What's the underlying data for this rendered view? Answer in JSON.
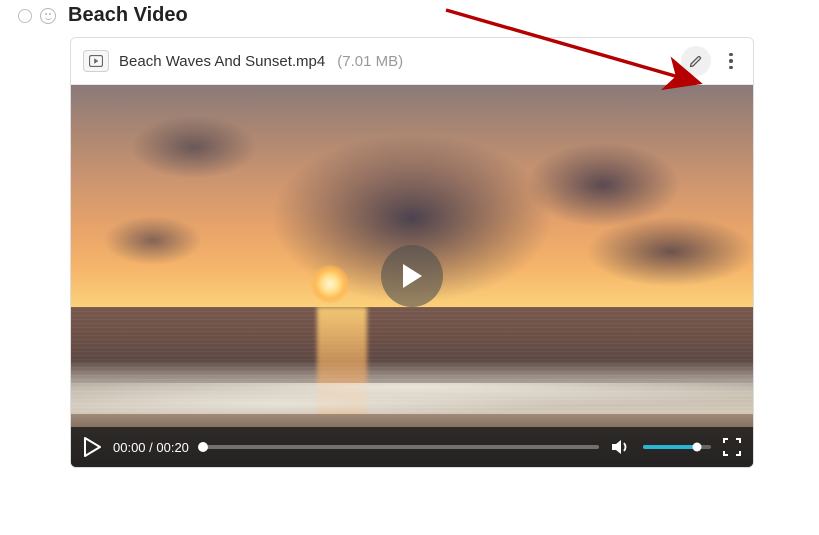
{
  "header": {
    "title": "Beach Video"
  },
  "attachment": {
    "filename": "Beach Waves And Sunset.mp4",
    "filesize": "(7.01 MB)"
  },
  "player": {
    "current_time": "00:00",
    "duration": "00:20",
    "time_display": "00:00 / 00:20"
  }
}
